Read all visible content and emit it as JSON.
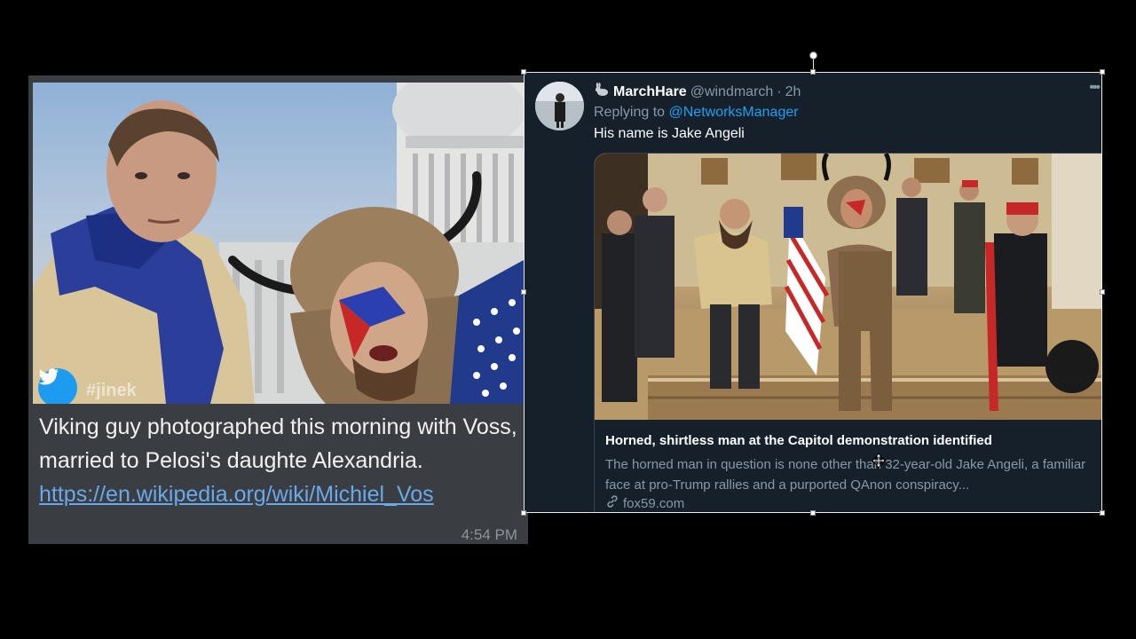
{
  "message": {
    "watermark": "#jinek",
    "text_plain": "Viking guy photographed this morning with Voss, married to Pelosi's daughte Alexandria. ",
    "link": "https://en.wikipedia.org/wiki/Michiel_Vos",
    "time": "4:54 PM"
  },
  "tweet": {
    "display_name": "MarchHare",
    "handle": "@windmarch",
    "separator": "·",
    "age": "2h",
    "more": "•••",
    "replying_prefix": "Replying to",
    "replying_to": "@NetworksManager",
    "body": "His name is Jake Angeli",
    "card": {
      "title": "Horned, shirtless man at the Capitol demonstration identified",
      "description": "The horned man in question is none other than 32-year-old Jake Angeli, a familiar face at pro-Trump rallies and a purported QAnon conspiracy...",
      "domain": "fox59.com"
    }
  },
  "colors": {
    "tweet_bg": "#15202b",
    "link_blue": "#1da1f2",
    "message_bg": "#3a3d42",
    "message_link": "#6aa9e9",
    "twitter_blue": "#1d9bf0"
  },
  "icons": {
    "twitter_badge": "twitter-bird-icon",
    "name_emoji": "rabbit-icon",
    "more": "more-options-icon",
    "link": "link-icon",
    "cursor": "move-cursor-icon"
  }
}
